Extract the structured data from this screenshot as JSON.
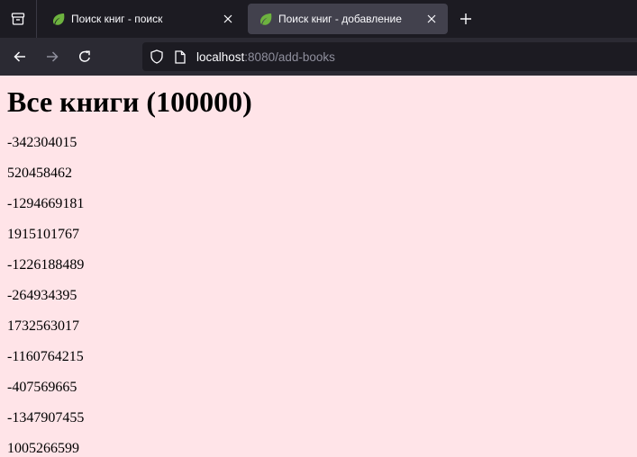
{
  "browser": {
    "tabs": [
      {
        "title": "Поиск книг - поиск",
        "active": false,
        "favicon": "spring-leaf-icon"
      },
      {
        "title": "Поиск книг - добавление",
        "active": true,
        "favicon": "spring-leaf-icon"
      }
    ],
    "url": {
      "host": "localhost",
      "rest": ":8080/add-books"
    }
  },
  "page": {
    "heading": "Все книги (100000)",
    "books": [
      "-342304015",
      "520458462",
      "-1294669181",
      "1915101767",
      "-1226188489",
      "-264934395",
      "1732563017",
      "-1160764215",
      "-407569665",
      "-1347907455",
      "1005266599"
    ]
  },
  "colors": {
    "page_background": "#ffe4e8",
    "chrome_dark": "#1c1b22",
    "toolbar": "#2b2a33",
    "active_tab": "#42414d",
    "spring_green": "#6db33f"
  }
}
